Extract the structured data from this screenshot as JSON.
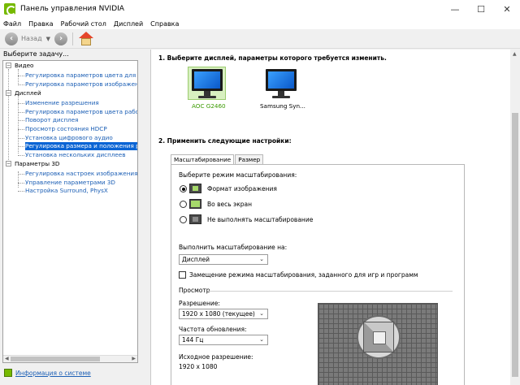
{
  "window": {
    "title": "Панель управления NVIDIA",
    "controls": {
      "minimize": "—",
      "maximize": "☐",
      "close": "✕"
    }
  },
  "menu": [
    "Файл",
    "Правка",
    "Рабочий стол",
    "Дисплей",
    "Справка"
  ],
  "toolbar": {
    "back_label": "Назад",
    "back_icon": "arrow-left-icon",
    "forward_icon": "arrow-right-icon",
    "home_icon": "home-icon"
  },
  "sidebar": {
    "header": "Выберите задачу...",
    "categories": [
      {
        "label": "Видео",
        "items": [
          "Регулировка параметров цвета для вид",
          "Регулировка параметров изображения д"
        ]
      },
      {
        "label": "Дисплей",
        "items": [
          "Изменение разрешения",
          "Регулировка параметров цвета рабочег",
          "Поворот дисплея",
          "Просмотр состояния HDCP",
          "Установка цифрового аудио",
          "Регулировка размера и положения рабо",
          "Установка нескольких дисплеев"
        ]
      },
      {
        "label": "Параметры 3D",
        "items": [
          "Регулировка настроек изображения с пр",
          "Управление параметрами 3D",
          "Настройка Surround, PhysX"
        ]
      }
    ],
    "selected": "Регулировка размера и положения рабо",
    "system_info": "Информация о системе"
  },
  "main": {
    "step1_title": "1. Выберите дисплей, параметры которого требуется изменить.",
    "displays": [
      {
        "name": "AOC G2460",
        "selected": true
      },
      {
        "name": "Samsung Syn...",
        "selected": false
      }
    ],
    "step2_title": "2. Применить следующие настройки:",
    "tabs": [
      "Масштабирование",
      "Размер"
    ],
    "active_tab": "Масштабирование",
    "scaling_mode_label": "Выберите режим масштабирования:",
    "scaling_options": [
      {
        "label": "Формат изображения",
        "checked": true
      },
      {
        "label": "Во весь экран",
        "checked": false
      },
      {
        "label": "Не выполнять масштабирование",
        "checked": false
      }
    ],
    "perform_on_label": "Выполнить масштабирование на:",
    "perform_on_value": "Дисплей",
    "override_label": "Замещение режима масштабирования, заданного для игр и программ",
    "override_checked": false,
    "preview_title": "Просмотр",
    "resolution_label": "Разрешение:",
    "resolution_value": "1920 x 1080 (текущее)",
    "refresh_label": "Частота обновления:",
    "refresh_value": "144 Гц",
    "source_res_label": "Исходное разрешение:",
    "source_res_value": "1920 x 1080"
  }
}
